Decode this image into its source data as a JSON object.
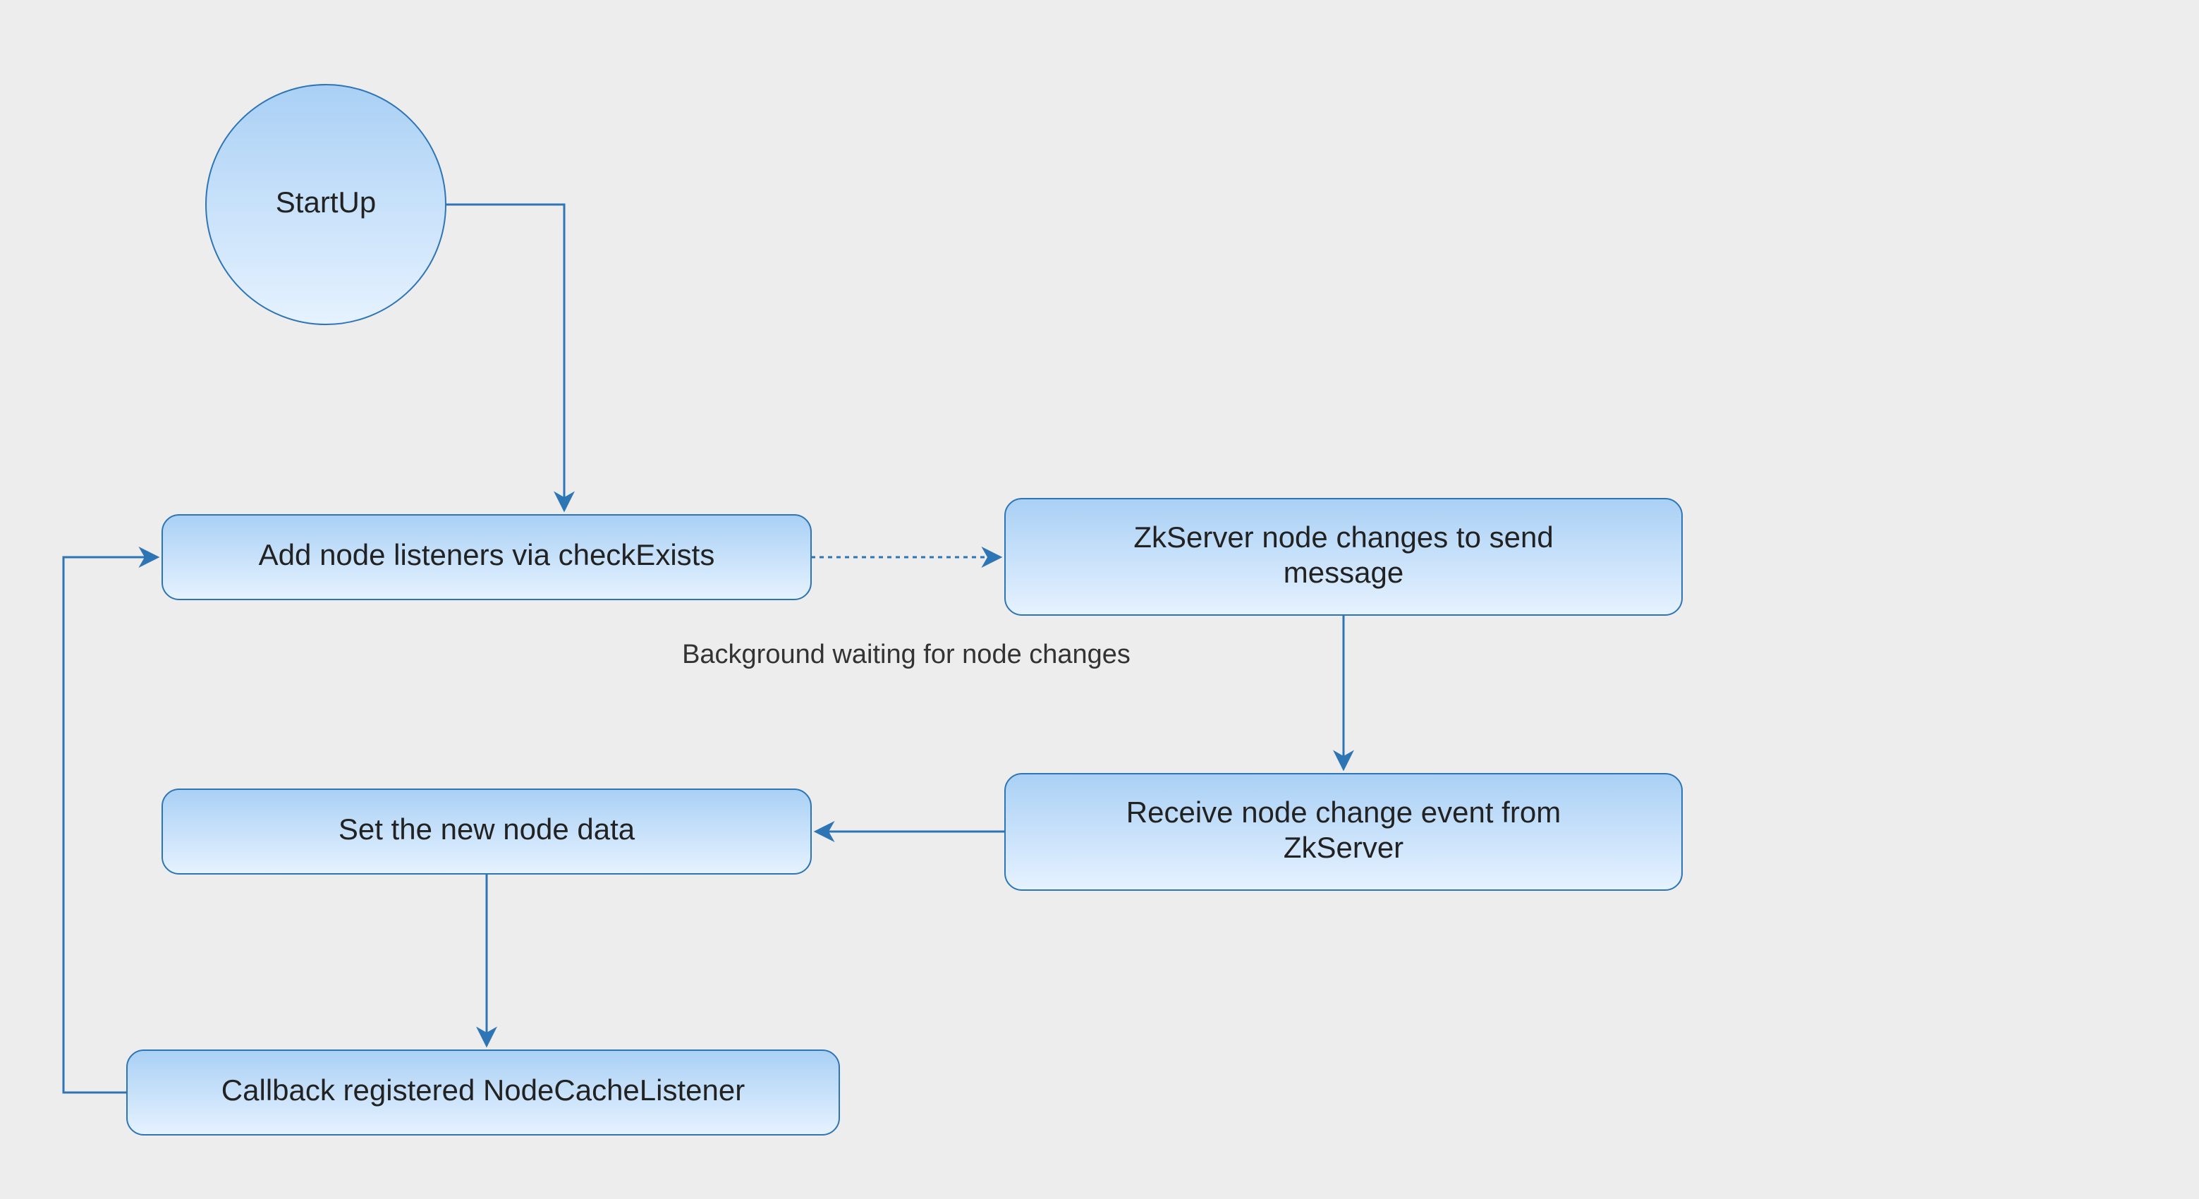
{
  "diagram": {
    "nodes": {
      "startup": {
        "label": "StartUp"
      },
      "addNode": {
        "label": "Add node listeners via checkExists"
      },
      "zkSend": {
        "line1": "ZkServer node changes to send",
        "line2": "message"
      },
      "receive": {
        "line1": "Receive node change event from",
        "line2": "ZkServer"
      },
      "setData": {
        "label": "Set the new node data"
      },
      "callback": {
        "label": "Callback registered NodeCacheListener"
      }
    },
    "edgeLabel": "Background waiting for node changes"
  }
}
